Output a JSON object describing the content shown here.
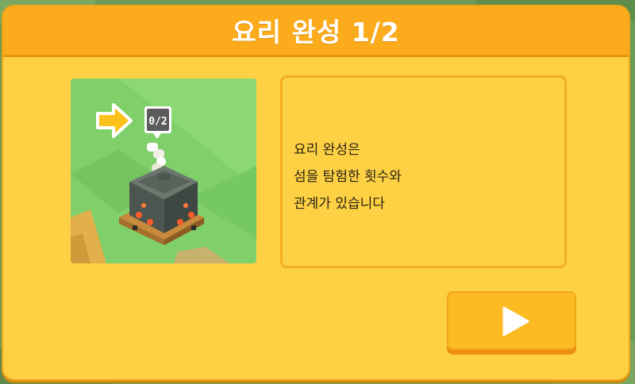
{
  "dialog": {
    "title": "요리 완성 1/2",
    "description_lines": [
      "요리 완성은",
      "섬을 탐험한 횟수와",
      "관계가 있습니다"
    ],
    "preview": {
      "counter_label": "0/2",
      "pointer_icon": "arrow-right-icon",
      "object_icon": "cooking-pot-icon"
    },
    "next_button_icon": "play-icon"
  },
  "colors": {
    "panel": "#fdd143",
    "header": "#fbab1b",
    "button": "#fcbb22",
    "button_shadow": "#ee8d14",
    "grass": "#7fcf6a"
  }
}
